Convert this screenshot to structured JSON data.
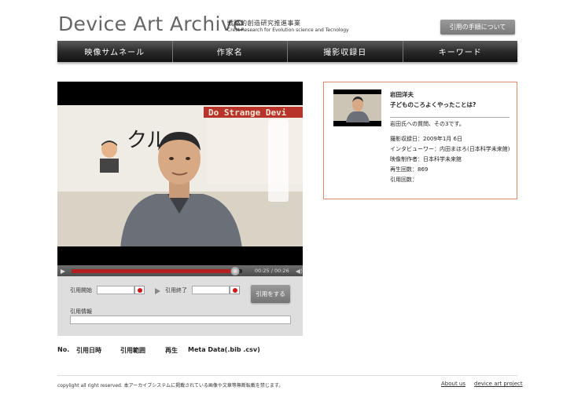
{
  "header": {
    "site_title": "Device Art Archive",
    "subtitle_jp": "戦略的創造研究推進事業",
    "subtitle_en": "Crest Research for Evolution science and Tecnology",
    "citation_guide_label": "引用の手順について"
  },
  "nav": {
    "items": [
      {
        "label": "映像サムネール"
      },
      {
        "label": "作家名"
      },
      {
        "label": "撮影収録日"
      },
      {
        "label": "キーワード"
      }
    ]
  },
  "video": {
    "poster_text": "Do Strange Devi",
    "kana_text": "クル",
    "time_display": "00:25 / 00:26",
    "progress": 0.96,
    "play_icon": "play-icon",
    "volume_icon": "volume-icon"
  },
  "citation": {
    "start_label": "引用開始",
    "end_label": "引用終了",
    "button_label": "引用をする",
    "info_label": "引用情報",
    "start_value": "",
    "end_value": ""
  },
  "table": {
    "headers": [
      "No.",
      "引用日時",
      "引用範囲",
      "再生",
      "Meta Data(.bib .csv)"
    ]
  },
  "card": {
    "name": "岩田洋夫",
    "title": "子どものころよくやったことは?",
    "description": "岩田氏への質問、その3です。",
    "meta": [
      "撮影収録日：2009年1月 6日",
      "インタビューワー：内田まほろ(日本科学未来館)",
      "映像制作者：日本科学未来館",
      "再生回数：869",
      "引用回数："
    ]
  },
  "footer": {
    "copyright": "copylight all right reserved. 本アーカイブシステムに掲載されている画像や文章等無断転載を禁じます。",
    "about_link": "About us",
    "project_link": "device art project"
  },
  "colors": {
    "accent_red": "#b31e1e",
    "card_border": "#e08a6f",
    "nav_bg": "#2b2b2b"
  }
}
